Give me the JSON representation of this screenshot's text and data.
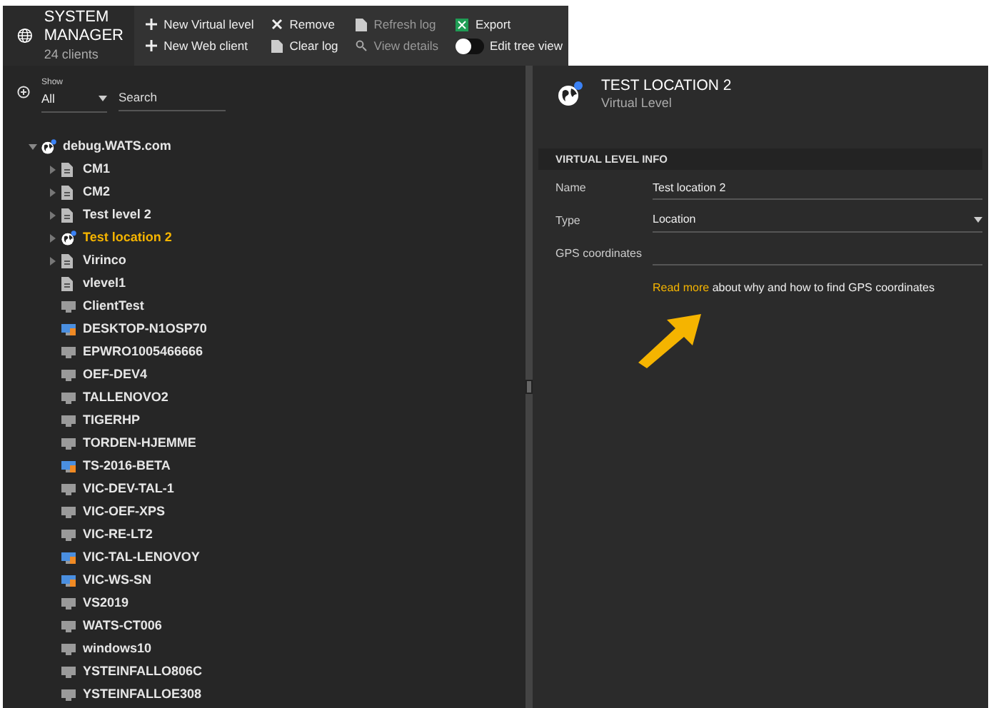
{
  "app": {
    "title": "SYSTEM MANAGER",
    "subtitle": "24 clients"
  },
  "toolbar": [
    {
      "label": "New Virtual level",
      "kind": "plus",
      "disabled": false
    },
    {
      "label": "New Web client",
      "kind": "plus",
      "disabled": false
    },
    {
      "label": "Remove",
      "kind": "remove",
      "disabled": false
    },
    {
      "label": "Clear log",
      "kind": "doc",
      "disabled": false
    },
    {
      "label": "Refresh log",
      "kind": "doc",
      "disabled": true
    },
    {
      "label": "View details",
      "kind": "search",
      "disabled": true
    },
    {
      "label": "Export",
      "kind": "excel",
      "disabled": false
    },
    {
      "label": "Edit tree view",
      "kind": "toggle",
      "on": false
    }
  ],
  "filter": {
    "show_label": "Show",
    "show_value": "All",
    "search_placeholder": "Search"
  },
  "tree": [
    {
      "label": "debug.WATS.com",
      "kind": "root",
      "expanded": true,
      "selected": false,
      "children": [
        {
          "label": "CM1",
          "kind": "level",
          "expanded": false,
          "selected": false
        },
        {
          "label": "CM2",
          "kind": "level",
          "expanded": false,
          "selected": false
        },
        {
          "label": "Test level 2",
          "kind": "level",
          "expanded": false,
          "selected": false
        },
        {
          "label": "Test location 2",
          "kind": "location",
          "expanded": false,
          "selected": true
        },
        {
          "label": "Virinco",
          "kind": "level",
          "expanded": false,
          "selected": false
        },
        {
          "label": "vlevel1",
          "kind": "level",
          "selected": false
        },
        {
          "label": "ClientTest",
          "kind": "client",
          "selected": false
        },
        {
          "label": "DESKTOP-N1OSP70",
          "kind": "client_alert",
          "selected": false
        },
        {
          "label": "EPWRO1005466666",
          "kind": "client",
          "selected": false
        },
        {
          "label": "OEF-DEV4",
          "kind": "client",
          "selected": false
        },
        {
          "label": "TALLENOVO2",
          "kind": "client",
          "selected": false
        },
        {
          "label": "TIGERHP",
          "kind": "client",
          "selected": false
        },
        {
          "label": "TORDEN-HJEMME",
          "kind": "client",
          "selected": false
        },
        {
          "label": "TS-2016-BETA",
          "kind": "client_alert",
          "selected": false
        },
        {
          "label": "VIC-DEV-TAL-1",
          "kind": "client",
          "selected": false
        },
        {
          "label": "VIC-OEF-XPS",
          "kind": "client",
          "selected": false
        },
        {
          "label": "VIC-RE-LT2",
          "kind": "client",
          "selected": false
        },
        {
          "label": "VIC-TAL-LENOVOY",
          "kind": "client_alert",
          "selected": false
        },
        {
          "label": "VIC-WS-SN",
          "kind": "client_alert",
          "selected": false
        },
        {
          "label": "VS2019",
          "kind": "client",
          "selected": false
        },
        {
          "label": "WATS-CT006",
          "kind": "client",
          "selected": false
        },
        {
          "label": "windows10",
          "kind": "client",
          "selected": false
        },
        {
          "label": "YSTEINFALLO806C",
          "kind": "client",
          "selected": false
        },
        {
          "label": "YSTEINFALLOE308",
          "kind": "client",
          "selected": false
        }
      ]
    }
  ],
  "detail": {
    "title": "TEST LOCATION 2",
    "subtitle": "Virtual Level",
    "section": "VIRTUAL LEVEL INFO",
    "fields": [
      {
        "label": "Name",
        "value": "Test location 2",
        "kind": "text"
      },
      {
        "label": "Type",
        "value": "Location",
        "kind": "select"
      },
      {
        "label": "GPS coordinates",
        "kind": "text"
      }
    ],
    "help": {
      "link": "Read more",
      "text": "about why and how to find GPS coordinates"
    }
  }
}
